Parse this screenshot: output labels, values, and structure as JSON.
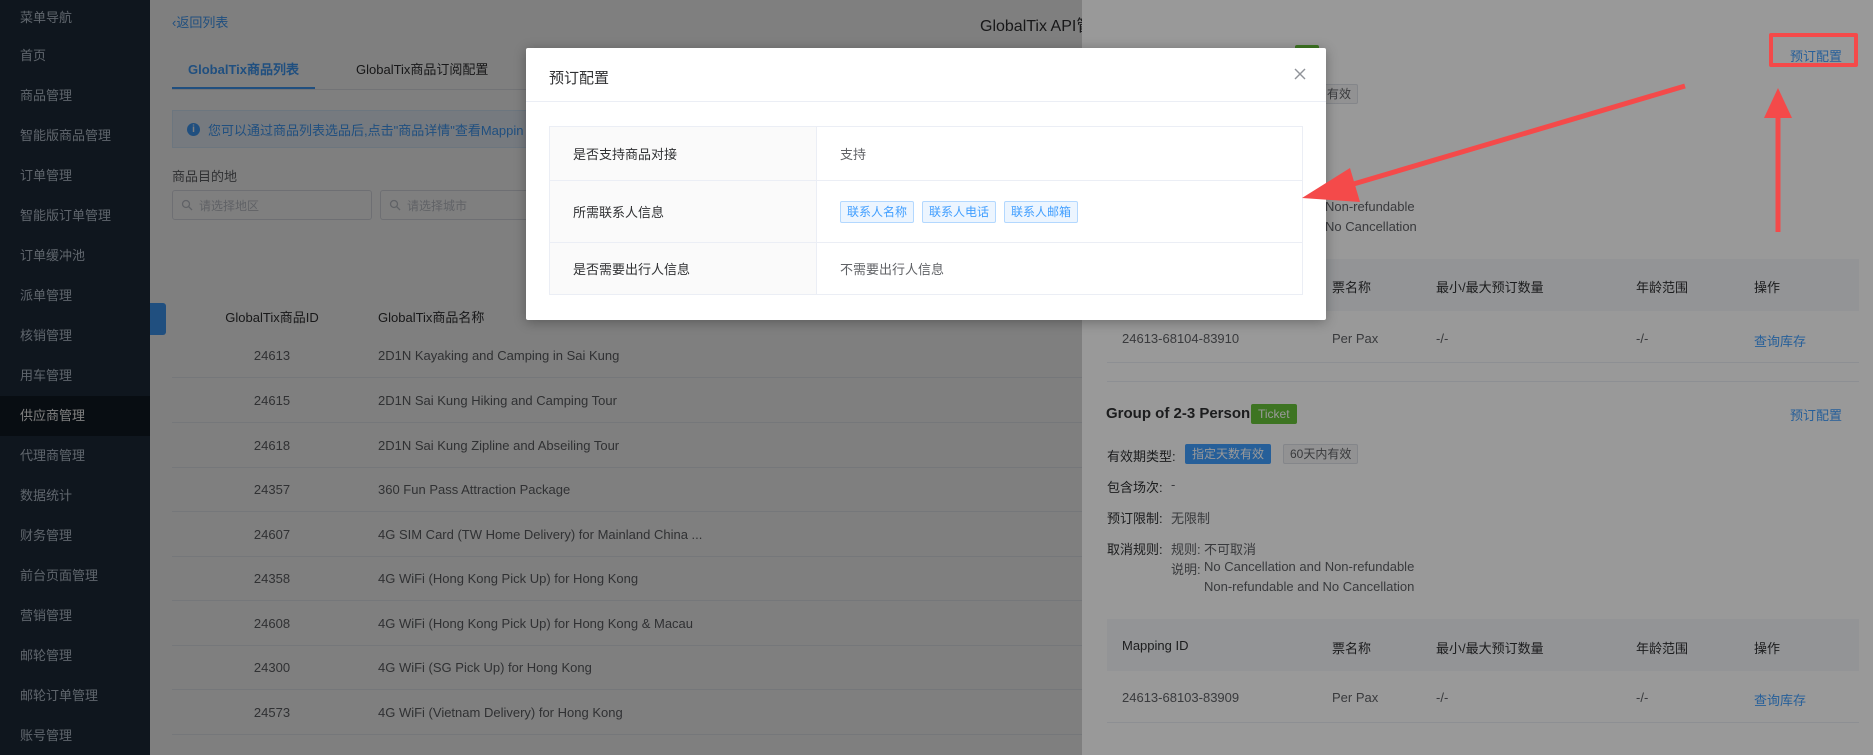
{
  "sidebar": {
    "items": [
      {
        "label": "菜单导航"
      },
      {
        "label": "首页"
      },
      {
        "label": "商品管理"
      },
      {
        "label": "智能版商品管理"
      },
      {
        "label": "订单管理"
      },
      {
        "label": "智能版订单管理"
      },
      {
        "label": "订单缓冲池"
      },
      {
        "label": "派单管理"
      },
      {
        "label": "核销管理"
      },
      {
        "label": "用车管理"
      },
      {
        "label": "供应商管理"
      },
      {
        "label": "代理商管理"
      },
      {
        "label": "数据统计"
      },
      {
        "label": "财务管理"
      },
      {
        "label": "前台页面管理"
      },
      {
        "label": "营销管理"
      },
      {
        "label": "邮轮管理"
      },
      {
        "label": "邮轮订单管理"
      },
      {
        "label": "账号管理"
      }
    ],
    "active_index": 10
  },
  "main": {
    "back_label": "返回列表",
    "page_title": "GlobalTix API管",
    "tabs": [
      {
        "label": "GlobalTix商品列表"
      },
      {
        "label": "GlobalTix商品订阅配置"
      }
    ],
    "alert_text": "您可以通过商品列表选品后,点击\"商品详情\"查看Mappin",
    "filter_label": "商品目的地",
    "region_placeholder": "请选择地区",
    "city_placeholder": "请选择城市",
    "table_headers": {
      "id": "GlobalTix商品ID",
      "name": "GlobalTix商品名称"
    },
    "rows": [
      {
        "id": "24613",
        "name": "2D1N Kayaking and Camping in Sai Kung"
      },
      {
        "id": "24615",
        "name": "2D1N Sai Kung Hiking and Camping Tour"
      },
      {
        "id": "24618",
        "name": "2D1N Sai Kung Zipline and Abseiling Tour"
      },
      {
        "id": "24357",
        "name": "360 Fun Pass Attraction Package"
      },
      {
        "id": "24607",
        "name": "4G SIM Card (TW Home Delivery) for Mainland China ..."
      },
      {
        "id": "24358",
        "name": "4G WiFi (Hong Kong Pick Up) for Hong Kong"
      },
      {
        "id": "24608",
        "name": "4G WiFi (Hong Kong Pick Up) for Hong Kong & Macau"
      },
      {
        "id": "24300",
        "name": "4G WiFi (SG Pick Up) for Hong Kong"
      },
      {
        "id": "24573",
        "name": "4G WiFi (Vietnam Delivery) for Hong Kong"
      }
    ]
  },
  "drawer": {
    "top_tag": "Ticket",
    "top_tag_visible": "et",
    "top_validity_tag": "有效",
    "booking_config_label": "预订配置",
    "top_desc_lines": [
      "Non-refundable",
      "No Cancellation"
    ],
    "table_headers": [
      "Mapping ID",
      "票名称",
      "最小/最大预订数量",
      "年龄范围",
      "操作"
    ],
    "first_row": {
      "mapping_id": "24613-68104-83910",
      "ticket_name": "Per Pax",
      "min_max": "-/-",
      "age": "-/-",
      "action": "查询库存"
    },
    "group2": {
      "title": "Group of 2-3 Person",
      "tag": "Ticket",
      "validity_label": "有效期类型:",
      "validity_type": "指定天数有效",
      "validity_days": "60天内有效",
      "sessions_label": "包含场次:",
      "sessions_value": "-",
      "limit_label": "预订限制:",
      "limit_value": "无限制",
      "cancel_label": "取消规则:",
      "rule_label": "规则:",
      "rule_value": "不可取消",
      "note_label": "说明:",
      "note_lines": [
        "No Cancellation and Non-refundable",
        "Non-refundable and No Cancellation"
      ],
      "row": {
        "mapping_id": "24613-68103-83909",
        "ticket_name": "Per Pax",
        "min_max": "-/-",
        "age": "-/-",
        "action": "查询库存"
      }
    }
  },
  "modal": {
    "title": "预订配置",
    "rows": [
      {
        "label": "是否支持商品对接",
        "value": "支持"
      },
      {
        "label": "所需联系人信息",
        "chips": [
          "联系人名称",
          "联系人电话",
          "联系人邮箱"
        ]
      },
      {
        "label": "是否需要出行人信息",
        "value": "不需要出行人信息"
      }
    ]
  },
  "colors": {
    "sidebar_bg": "#1f2d3d",
    "primary": "#409eff",
    "success": "#67c23a",
    "annotation_red": "#f44a4a"
  }
}
